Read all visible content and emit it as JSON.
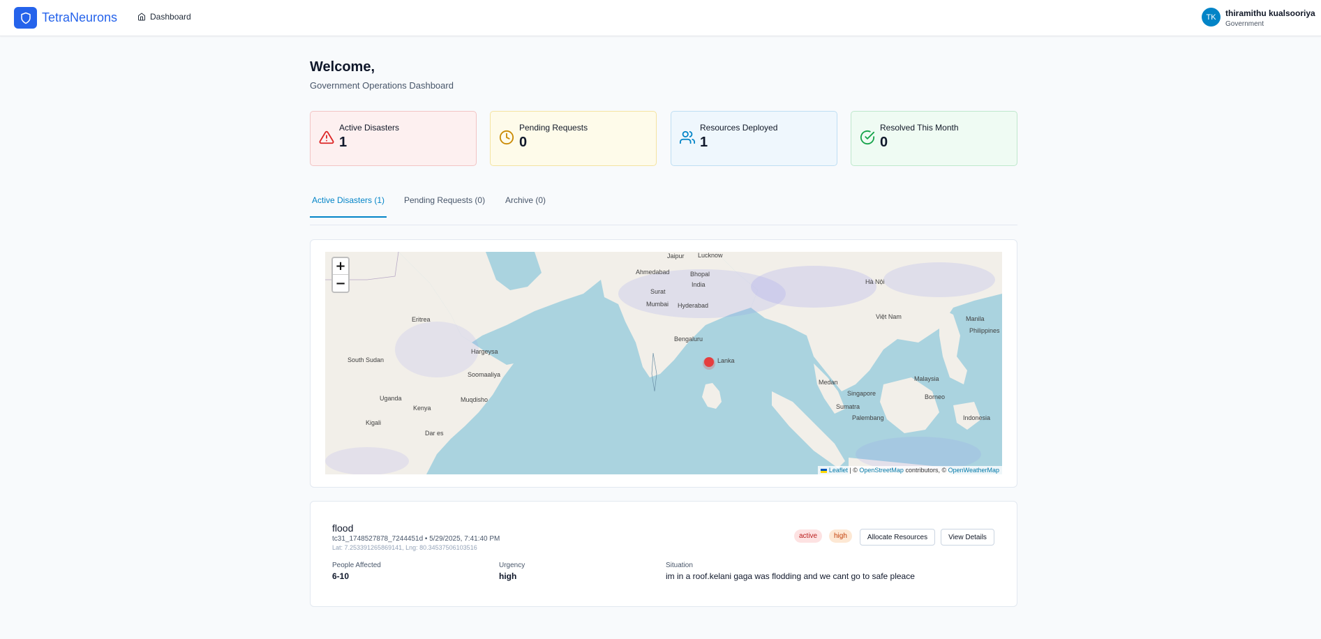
{
  "header": {
    "brand": "TetraNeurons",
    "nav_dashboard": "Dashboard",
    "user_initials": "TK",
    "user_name": "thiramithu kualsooriya",
    "user_role": "Government",
    "accent_color": "#2563eb"
  },
  "welcome": {
    "title": "Welcome,",
    "subtitle": "Government Operations Dashboard"
  },
  "stats": [
    {
      "label": "Active Disasters",
      "value": "1",
      "icon": "alert-triangle-icon",
      "color": "#dc2626"
    },
    {
      "label": "Pending Requests",
      "value": "0",
      "icon": "clock-icon",
      "color": "#ca8a04"
    },
    {
      "label": "Resources Deployed",
      "value": "1",
      "icon": "users-icon",
      "color": "#0284c7"
    },
    {
      "label": "Resolved This Month",
      "value": "0",
      "icon": "check-circle-icon",
      "color": "#16a34a"
    }
  ],
  "tabs": [
    {
      "label": "Active Disasters (1)",
      "active": true
    },
    {
      "label": "Pending Requests (0)",
      "active": false
    },
    {
      "label": "Archive (0)",
      "active": false
    }
  ],
  "map": {
    "zoom_in": "+",
    "zoom_out": "−",
    "attribution": {
      "leaflet": "Leaflet",
      "sep1": " | © ",
      "osm": "OpenStreetMap",
      "contrib": " contributors, © ",
      "owm": "OpenWeatherMap"
    },
    "labels": [
      {
        "text": "Jaipur"
      },
      {
        "text": "Lucknow"
      },
      {
        "text": "Ahmedabad"
      },
      {
        "text": "Bhopal"
      },
      {
        "text": "India"
      },
      {
        "text": "Surat"
      },
      {
        "text": "Mumbai"
      },
      {
        "text": "Hyderabad"
      },
      {
        "text": "Bengaluru"
      },
      {
        "text": "Hargeysa"
      },
      {
        "text": "Soomaaliya"
      },
      {
        "text": "Muqdisho"
      },
      {
        "text": "South Sudan"
      },
      {
        "text": "Uganda"
      },
      {
        "text": "Kenya"
      },
      {
        "text": "Kigali"
      },
      {
        "text": "Dar es"
      },
      {
        "text": "Eritrea"
      },
      {
        "text": "Medan"
      },
      {
        "text": "Singapore"
      },
      {
        "text": "Sumatra"
      },
      {
        "text": "Palembang"
      },
      {
        "text": "Malaysia"
      },
      {
        "text": "Borneo"
      },
      {
        "text": "Indonesia"
      },
      {
        "text": "Manila"
      },
      {
        "text": "Philippines"
      },
      {
        "text": "Việt Nam"
      },
      {
        "text": "Hà Nội"
      },
      {
        "text": "Lanka"
      }
    ],
    "marker_color": "#e53e3e"
  },
  "report": {
    "title": "flood",
    "meta": "tc31_1748527878_7244451d • 5/29/2025, 7:41:40 PM",
    "coords": "Lat: 7.253391265869141, Lng: 80.34537506103516",
    "status_badge": "active",
    "urgency_badge": "high",
    "allocate_label": "Allocate Resources",
    "view_label": "View Details",
    "people_label": "People Affected",
    "people_value": "6-10",
    "urgency_label": "Urgency",
    "urgency_value": "high",
    "situation_label": "Situation",
    "situation_value": "im in a roof.kelani gaga was flodding and we cant go to safe pleace"
  }
}
